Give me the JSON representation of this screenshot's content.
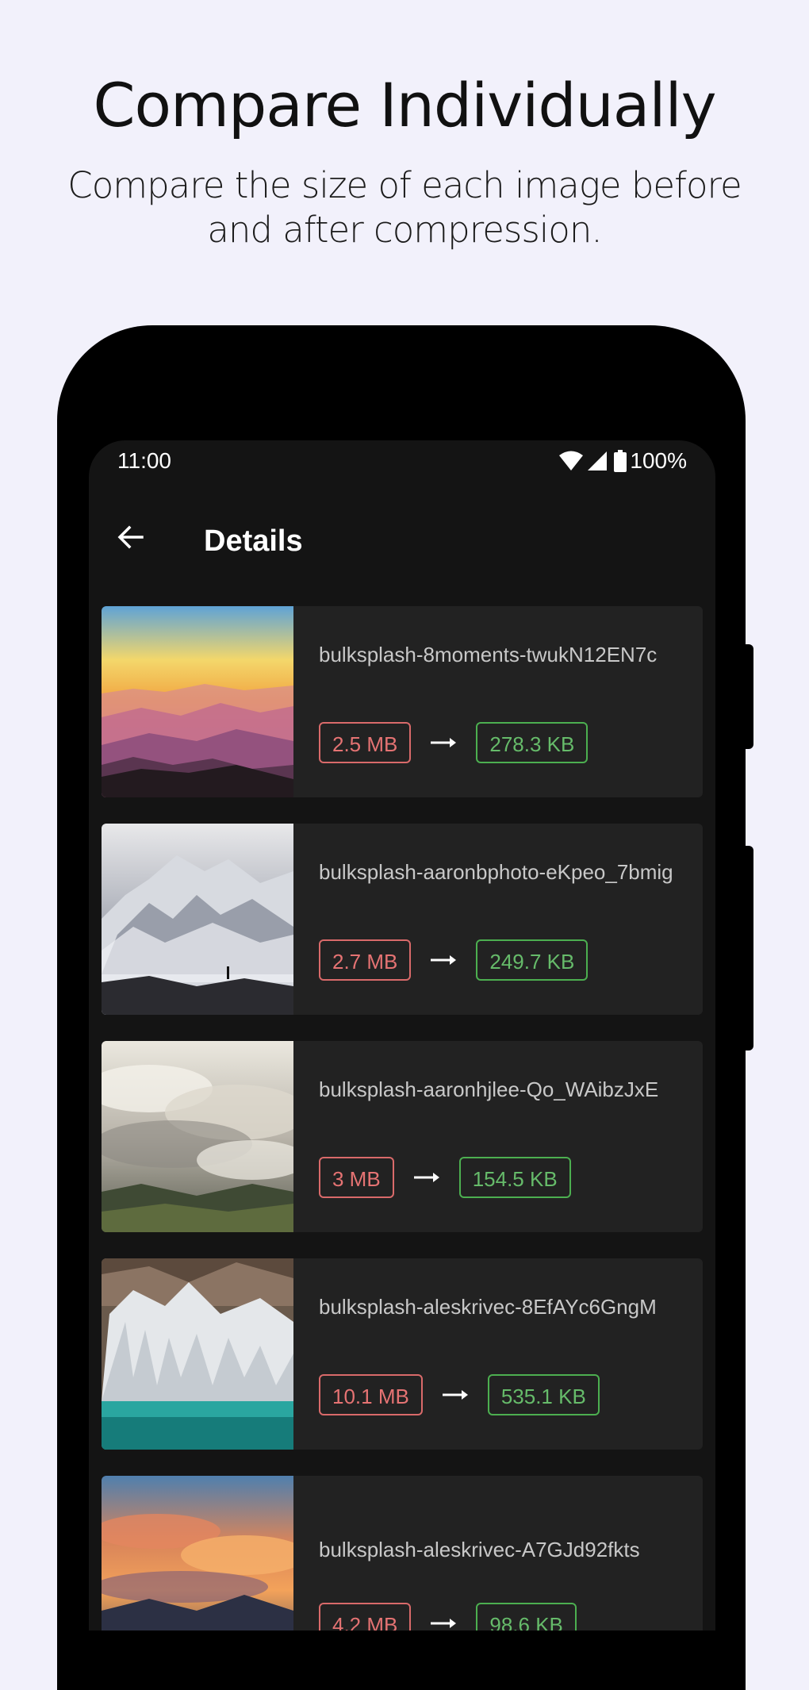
{
  "promo": {
    "title": "Compare Individually",
    "subtitle": "Compare the size of each image before and after compression."
  },
  "status_bar": {
    "time": "11:00",
    "battery": "100%",
    "icons": [
      "wifi-icon",
      "cell-signal-icon",
      "battery-icon"
    ]
  },
  "app_bar": {
    "title": "Details",
    "back_icon": "arrow-back-icon"
  },
  "images": [
    {
      "name": "bulksplash-8moments-twukN12EN7c",
      "before": "2.5 MB",
      "after": "278.3 KB",
      "thumb": "mountain-sunset-thumbnail"
    },
    {
      "name": "bulksplash-aaronbphoto-eKpeo_7bmig",
      "before": "2.7 MB",
      "after": "249.7 KB",
      "thumb": "snowy-mountain-thumbnail"
    },
    {
      "name": "bulksplash-aaronhjlee-Qo_WAibzJxE",
      "before": "3 MB",
      "after": "154.5 KB",
      "thumb": "clouds-over-valley-thumbnail"
    },
    {
      "name": "bulksplash-aleskrivec-8EfAYc6GngM",
      "before": "10.1 MB",
      "after": "535.1 KB",
      "thumb": "frozen-waterfall-thumbnail"
    },
    {
      "name": "bulksplash-aleskrivec-A7GJd92fkts",
      "before": "4.2 MB",
      "after": "98.6 KB",
      "thumb": "sunset-clouds-thumbnail"
    }
  ],
  "colors": {
    "background": "#f2f1fb",
    "screen": "#141414",
    "card": "#222222",
    "before_size": "#e57373",
    "after_size": "#66bb6a"
  }
}
